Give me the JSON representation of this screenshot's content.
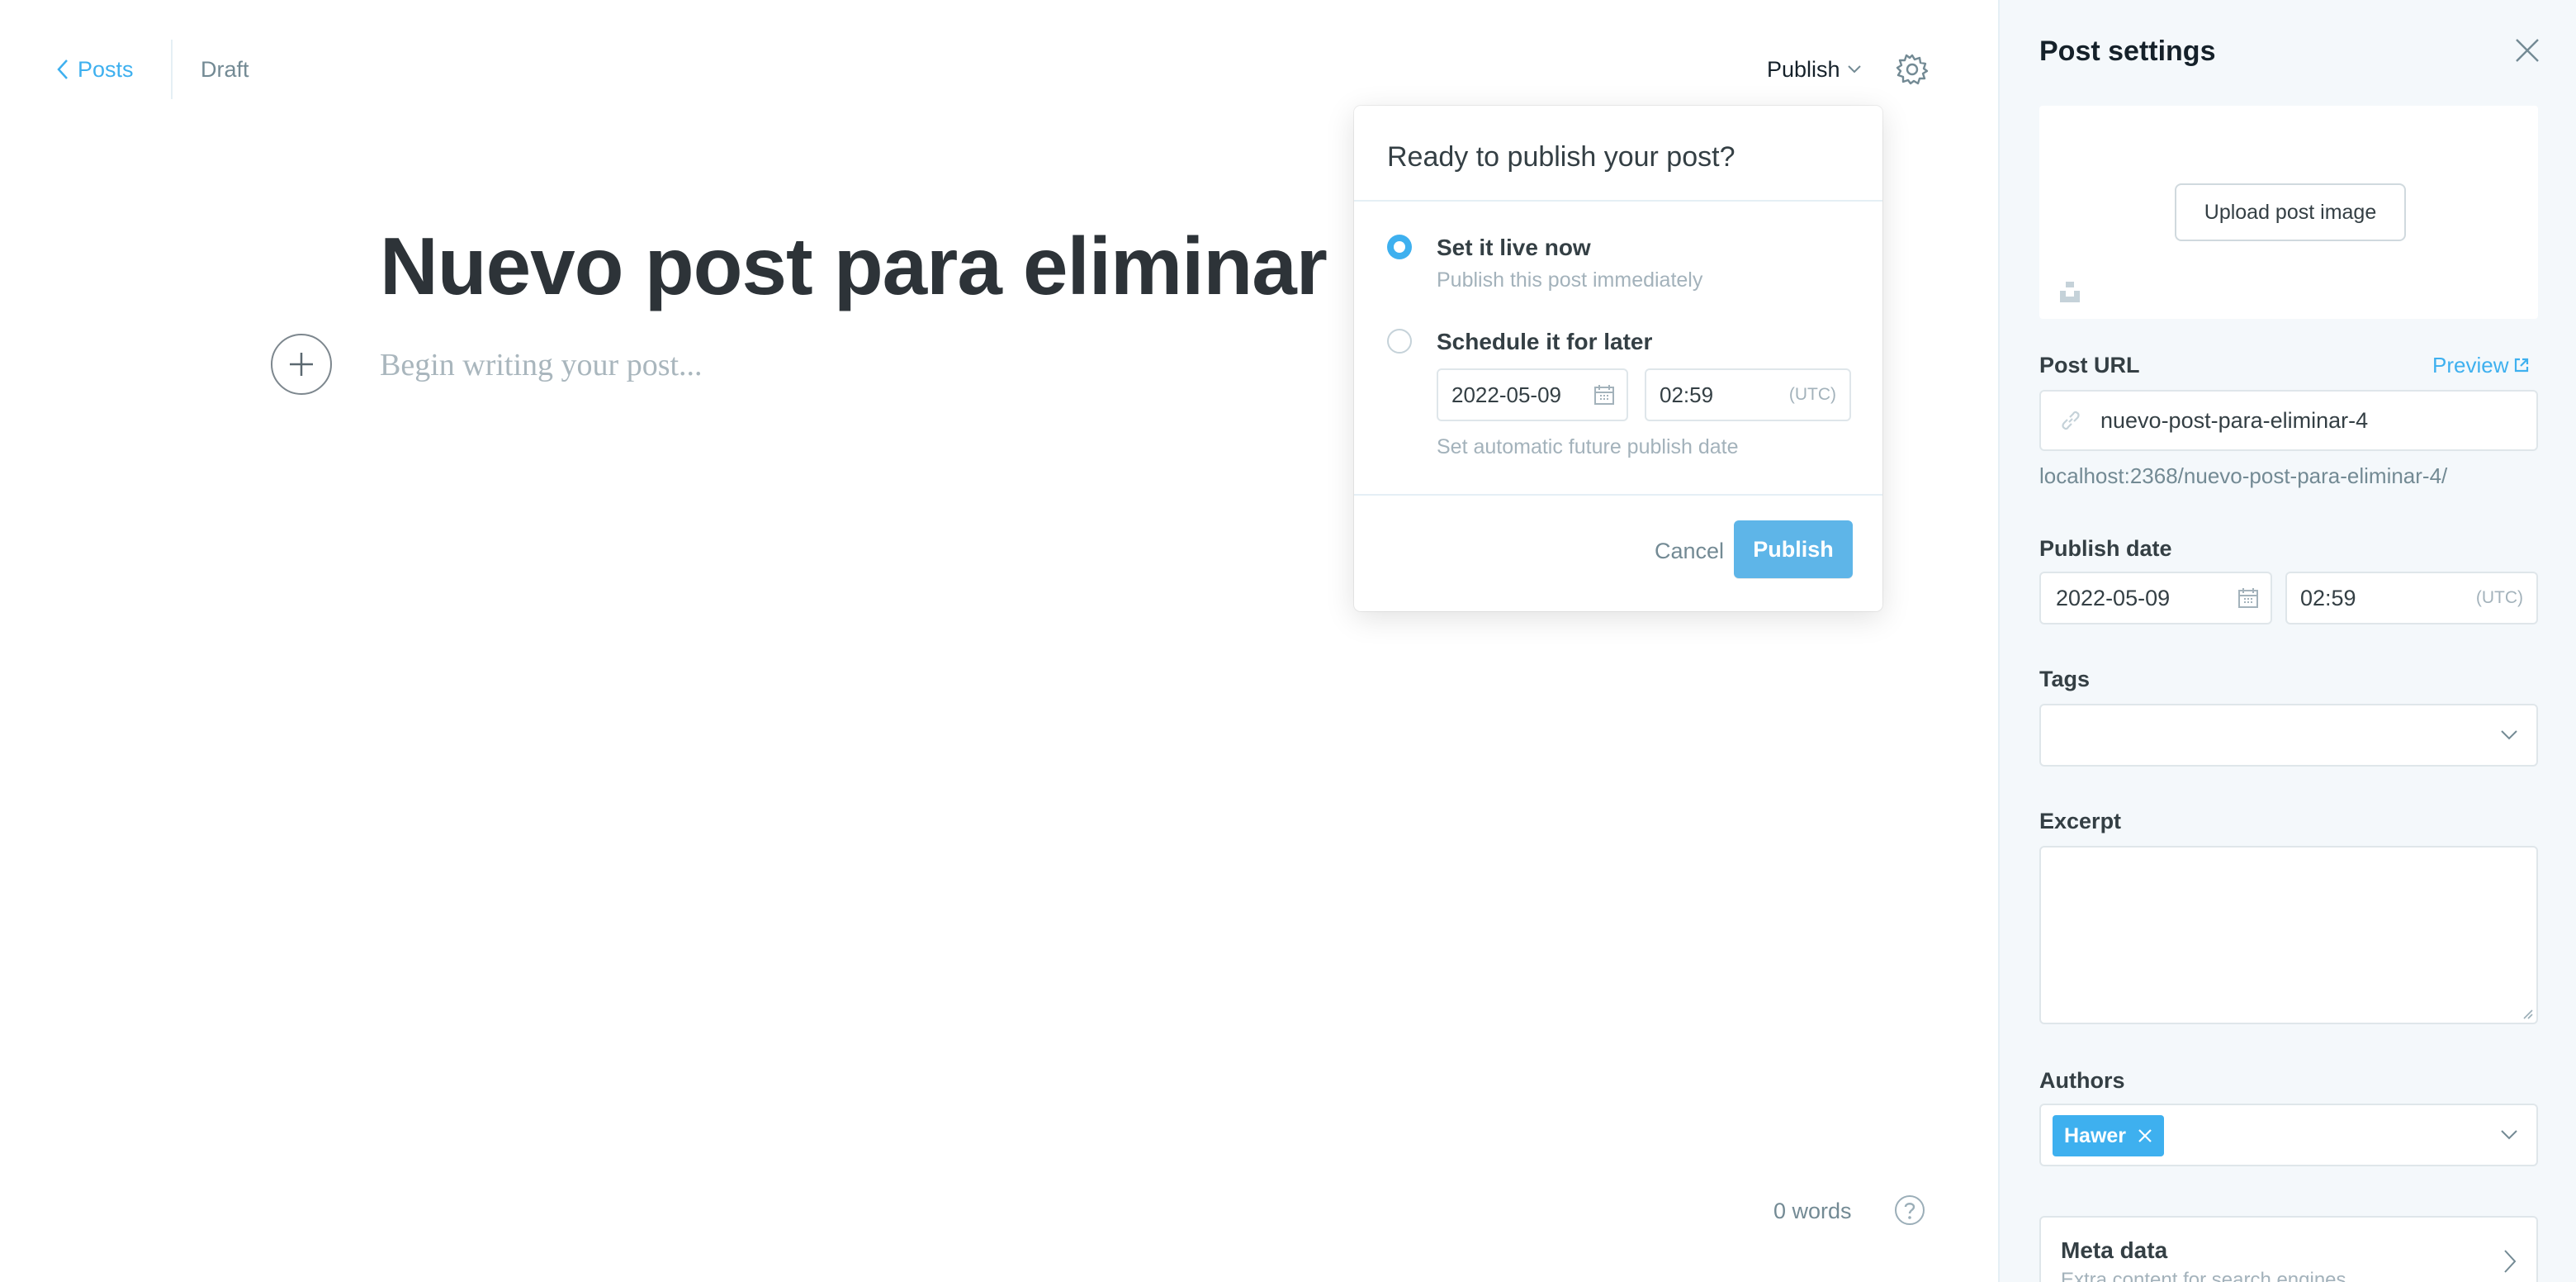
{
  "breadcrumb": {
    "back_label": "Posts",
    "status": "Draft"
  },
  "header": {
    "publish_label": "Publish"
  },
  "editor": {
    "title": "Nuevo post para eliminar",
    "body_placeholder": "Begin writing your post...",
    "word_count": "0 words"
  },
  "publish_menu": {
    "heading": "Ready to publish your post?",
    "option_now": {
      "title": "Set it live now",
      "description": "Publish this post immediately",
      "selected": true
    },
    "option_later": {
      "title": "Schedule it for later",
      "date": "2022-05-09",
      "time": "02:59",
      "timezone": "(UTC)",
      "hint": "Set automatic future publish date",
      "selected": false
    },
    "cancel_label": "Cancel",
    "publish_label": "Publish"
  },
  "settings": {
    "title": "Post settings",
    "upload_image_label": "Upload post image",
    "post_url_label": "Post URL",
    "preview_label": "Preview",
    "post_url_value": "nuevo-post-para-eliminar-4",
    "post_url_full": "localhost:2368/nuevo-post-para-eliminar-4/",
    "publish_date_label": "Publish date",
    "publish_date": "2022-05-09",
    "publish_time": "02:59",
    "publish_tz": "(UTC)",
    "tags_label": "Tags",
    "excerpt_label": "Excerpt",
    "authors_label": "Authors",
    "authors": [
      "Hawer"
    ],
    "meta_title": "Meta data",
    "meta_desc": "Extra content for search engines"
  },
  "colors": {
    "accent": "#3eb0ef",
    "publish_button": "#5eb5e8",
    "sidebar_bg": "#f4f8fb"
  }
}
